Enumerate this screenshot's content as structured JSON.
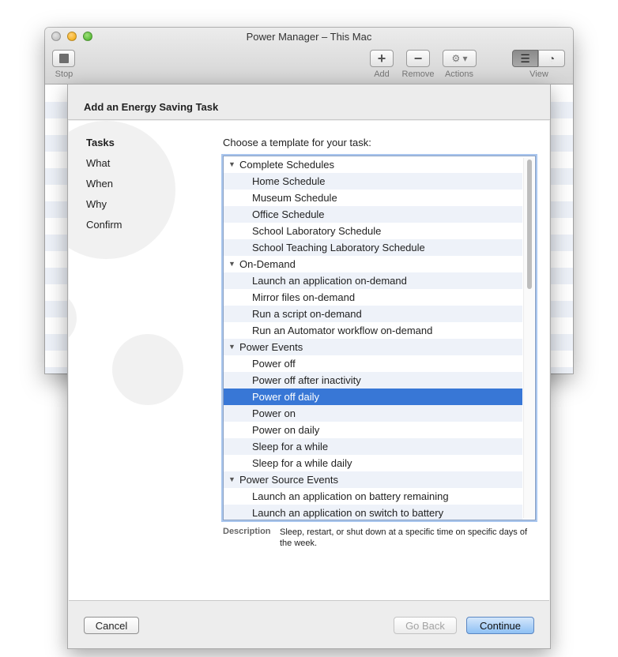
{
  "window": {
    "title": "Power Manager – This Mac"
  },
  "toolbar": {
    "stop_label": "Stop",
    "add_label": "Add",
    "remove_label": "Remove",
    "actions_label": "Actions",
    "view_label": "View",
    "add_glyph": "+",
    "remove_glyph": "−",
    "actions_glyph": "⚙ ▾",
    "list_view_glyph": "☰",
    "gauge_view_glyph": "◔"
  },
  "sheet": {
    "title": "Add an Energy Saving Task",
    "steps": [
      "Tasks",
      "What",
      "When",
      "Why",
      "Confirm"
    ],
    "active_step": "Tasks",
    "prompt": "Choose a template for your task:",
    "groups": [
      {
        "label": "Complete Schedules",
        "items": [
          "Home Schedule",
          "Museum Schedule",
          "Office Schedule",
          "School Laboratory Schedule",
          "School Teaching Laboratory Schedule"
        ]
      },
      {
        "label": "On-Demand",
        "items": [
          "Launch an application on-demand",
          "Mirror files on-demand",
          "Run a script on-demand",
          "Run an Automator workflow on-demand"
        ]
      },
      {
        "label": "Power Events",
        "items": [
          "Power off",
          "Power off after inactivity",
          "Power off daily",
          "Power on",
          "Power on daily",
          "Sleep for a while",
          "Sleep for a while daily"
        ]
      },
      {
        "label": "Power Source Events",
        "items": [
          "Launch an application on battery remaining",
          "Launch an application on switch to battery"
        ]
      }
    ],
    "selected_item": "Power off daily",
    "description_label": "Description",
    "description_text": "Sleep, restart, or shut down at a specific time on specific days of the week.",
    "buttons": {
      "cancel": "Cancel",
      "go_back": "Go Back",
      "continue": "Continue"
    }
  },
  "colors": {
    "selection": "#3877d6",
    "alt_row": "#eef2f9",
    "focus_ring": "#a9c6ee",
    "default_button": "#8ec0f4"
  }
}
